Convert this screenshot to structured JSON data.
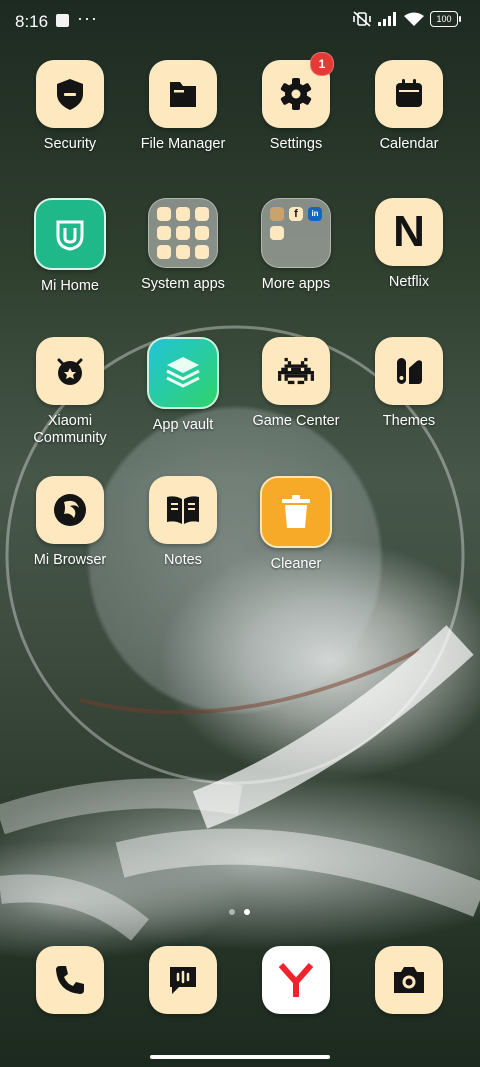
{
  "status_bar": {
    "time": "8:16",
    "dots": "···",
    "battery": "100"
  },
  "apps": [
    {
      "label": "Security",
      "icon": "shield-icon"
    },
    {
      "label": "File Manager",
      "icon": "folder-icon"
    },
    {
      "label": "Settings",
      "icon": "gear-icon",
      "badge": "1"
    },
    {
      "label": "Calendar",
      "icon": "calendar-icon"
    },
    {
      "label": "Mi Home",
      "icon": "mi-home-icon"
    },
    {
      "label": "System apps",
      "icon": "folder-icon"
    },
    {
      "label": "More apps",
      "icon": "folder-icon"
    },
    {
      "label": "Netflix",
      "icon": "netflix-icon"
    },
    {
      "label": "Xiaomi\nCommunity",
      "icon": "community-icon"
    },
    {
      "label": "App vault",
      "icon": "layers-icon"
    },
    {
      "label": "Game Center",
      "icon": "invader-icon"
    },
    {
      "label": "Themes",
      "icon": "themes-icon"
    },
    {
      "label": "Mi Browser",
      "icon": "browser-icon"
    },
    {
      "label": "Notes",
      "icon": "book-icon"
    },
    {
      "label": "Cleaner",
      "icon": "trash-icon"
    }
  ],
  "more_apps_mini": [
    "f",
    "in"
  ],
  "netflix_letter": "N",
  "dock": [
    {
      "icon": "phone-icon"
    },
    {
      "icon": "messages-icon"
    },
    {
      "icon": "yandex-icon"
    },
    {
      "icon": "camera-icon"
    }
  ],
  "colors": {
    "icon_bg": "#fde8bf",
    "icon_fg": "#141414",
    "badge": "#e53935",
    "cleaner_bg": "#f7a928",
    "mi_home_bg": "#1fb888",
    "app_vault_bg": "#2ccf6f"
  }
}
